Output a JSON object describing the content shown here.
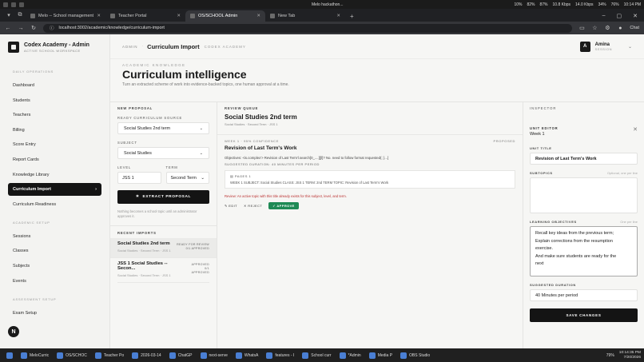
{
  "os_bar": {
    "media_title": "Melo hackathon...",
    "media_sub": "Media Player",
    "stats": [
      "10%",
      "82%",
      "87%",
      "10.8 Kbps",
      "14.0 Kbps",
      "34%",
      "76%",
      "10:14 PM"
    ]
  },
  "browser": {
    "tabs": [
      {
        "title": "Melo -- School management, attr",
        "active": false
      },
      {
        "title": "Teacher Portal",
        "active": false
      },
      {
        "title": "OS/SCHOOL Admin",
        "active": true
      },
      {
        "title": "New Tab",
        "active": false
      }
    ],
    "url": "localhost:3002/academic/knowledge/curriculum-import",
    "chat_label": "Chat"
  },
  "sidebar": {
    "brand_name": "Codex Academy - Admin",
    "brand_sub": "ACTIVE SCHOOL WORKSPACE",
    "sections": [
      {
        "label": "DAILY OPERATIONS",
        "items": [
          "Dashboard",
          "Students",
          "Teachers",
          "Billing",
          "Score Entry",
          "Report Cards",
          "Knowledge Library",
          "Curriculum Import",
          "Curriculum Readiness"
        ]
      },
      {
        "label": "ACADEMIC SETUP",
        "items": [
          "Sessions",
          "Classes",
          "Subjects",
          "Events"
        ]
      },
      {
        "label": "ASSESSMENT SETUP",
        "items": [
          "Exam Setup"
        ]
      }
    ],
    "active_item": "Curriculum Import",
    "float_badge": "N"
  },
  "header": {
    "crumb_admin": "ADMIN",
    "title": "Curriculum Import",
    "school": "CODEX ACADEMY",
    "user_initial": "A",
    "user_name": "Amina",
    "user_role": "SESSION"
  },
  "hero": {
    "eyebrow": "ACADEMIC KNOWLEDGE",
    "title": "Curriculum intelligence",
    "lead": "Turn an extracted scheme of work into evidence-backed topics, one human approval at a time."
  },
  "proposal": {
    "heading": "NEW PROPOSAL",
    "source_label": "READY CURRICULUM SOURCE",
    "source_value": "Social Studies 2nd term",
    "subject_label": "SUBJECT",
    "subject_value": "Social Studies",
    "level_label": "LEVEL",
    "level_value": "JSS 1",
    "term_label": "TERM",
    "term_value": "Second Term",
    "extract_label": "EXTRACT PROPOSAL",
    "note": "Nothing becomes a school topic until an administrator approves it.",
    "recent_heading": "RECENT IMPORTS",
    "recent": [
      {
        "title": "Social Studies 2nd term",
        "sub": "Social Studies · Second Term · JSS 1",
        "status": "READY FOR REVIEW",
        "count": "0/1 APPROVED"
      },
      {
        "title": "JSS 1 Social Studies -- Secon...",
        "sub": "Social Studies · Second Term · JSS 1",
        "status": "APPROVED",
        "count": "0/1 APPROVED"
      }
    ]
  },
  "review": {
    "heading": "REVIEW QUEUE",
    "title": "Social Studies 2nd term",
    "sub": "Social Studies · Second Term · JSS 1",
    "card_meta": "WEEK 1 · 95% CONFIDENCE",
    "card_status": "PROPOSED",
    "card_title": "Revision of Last Term's Work",
    "objectives": "Objectives: <is.complex'> Revision of Last Term'l.search[0_....]][l]? No. need to follow format requested(; }...[",
    "duration": "SUGGESTED DURATION: 40 MINUTES PER PERIOD",
    "pages_label": "PAGES 1",
    "pages_text": "WEEK 1 SUBJECT: Social Studies CLASS: JSS 1 TERM: 2nd TERM TOPIC: Revision of Last Term's Work",
    "review_note": "Review: An active topic with this title already exists for this subject, level, and term.",
    "edit": "EDIT",
    "reject": "REJECT",
    "approve": "APPROVE"
  },
  "inspector": {
    "heading": "INSPECTOR",
    "editor_label": "UNIT EDITOR",
    "editor_week": "Week 1",
    "unit_title_label": "UNIT TITLE",
    "unit_title_value": "Revision of Last Term's Work",
    "subtopics_label": "SUBTOPICS",
    "subtopics_hint": "Optional, one per line",
    "objectives_label": "LEARNING OBJECTIVES",
    "objectives_hint": "One per line",
    "objectives_lines": [
      "Recall key ideas from the previous term;",
      "Explain corrections from the resumption",
      "exercise.",
      "And make sure students are ready for the",
      "next"
    ],
    "duration_label": "SUGGESTED DURATION",
    "duration_value": "40 Minutes per period",
    "save_label": "SAVE CHANGES"
  },
  "taskbar": {
    "items": [
      "MeloCurric",
      "OS/SCHOC",
      "Teacher Po",
      "2026-03-14",
      "ChatGP",
      "next-serve",
      "WhatsA",
      "features - I",
      "School curr",
      "*Admin",
      "Media P",
      "OBS Studio"
    ],
    "battery": "79%",
    "time": "10:14:35 PM",
    "date": "7/20/2026"
  }
}
